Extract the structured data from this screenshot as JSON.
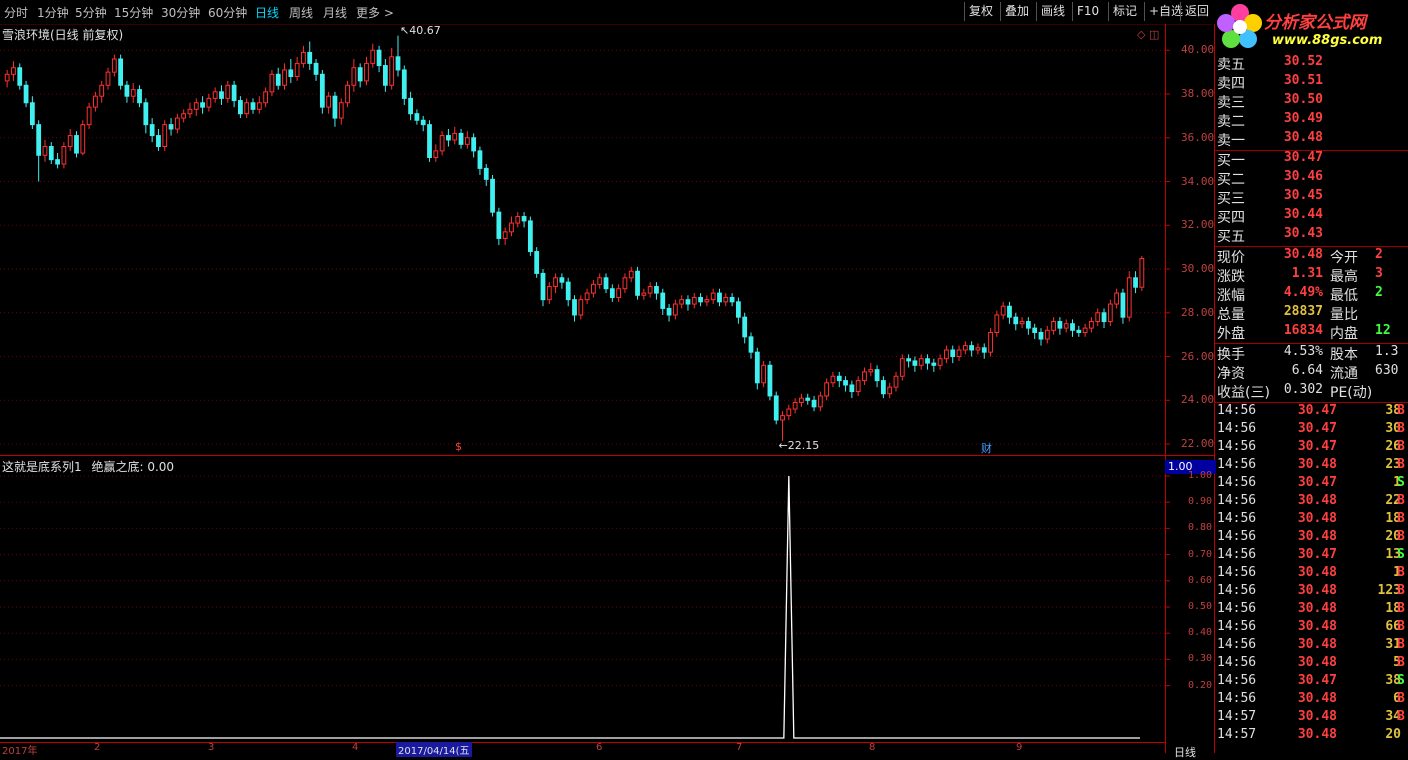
{
  "toolbar": {
    "periods": [
      "分时",
      "1分钟",
      "5分钟",
      "15分钟",
      "30分钟",
      "60分钟",
      "日线",
      "周线",
      "月线",
      "更多 >"
    ],
    "active_period": "日线",
    "buttons": [
      "复权",
      "叠加",
      "画线",
      "F10",
      "标记",
      "+自选",
      "返回"
    ]
  },
  "logo": {
    "name": "分析家公式网",
    "url": "www.88gs.com"
  },
  "main_chart": {
    "title": "雪浪环境(日线 前复权)",
    "y_labels": [
      "40.00",
      "38.00",
      "36.00",
      "34.00",
      "32.00",
      "30.00",
      "28.00",
      "26.00",
      "24.00",
      "22.00"
    ],
    "high_marker": "40.67",
    "low_marker": "22.15",
    "event_markers": [
      "$",
      "财"
    ],
    "colors": {
      "up": "#ff3030",
      "down": "#40f0f0",
      "grid": "#700000",
      "axis": "#c00000"
    }
  },
  "indicator": {
    "title": "这就是底系列1",
    "field_label": "绝赢之底:",
    "field_value": "0.00",
    "current_value": "1.00",
    "y_labels": [
      "1.00",
      "0.90",
      "0.80",
      "0.70",
      "0.60",
      "0.50",
      "0.40",
      "0.30",
      "0.20"
    ]
  },
  "x_axis": {
    "ticks": [
      "2017年",
      "2",
      "3",
      "4",
      "6",
      "7",
      "8",
      "9"
    ],
    "selected_date": "2017/04/14(五"
  },
  "order_book": {
    "asks": [
      {
        "label": "卖五",
        "price": "30.52"
      },
      {
        "label": "卖四",
        "price": "30.51"
      },
      {
        "label": "卖三",
        "price": "30.50"
      },
      {
        "label": "卖二",
        "price": "30.49"
      },
      {
        "label": "卖一",
        "price": "30.48"
      }
    ],
    "bids": [
      {
        "label": "买一",
        "price": "30.47"
      },
      {
        "label": "买二",
        "price": "30.46"
      },
      {
        "label": "买三",
        "price": "30.45"
      },
      {
        "label": "买四",
        "price": "30.44"
      },
      {
        "label": "买五",
        "price": "30.43"
      }
    ]
  },
  "quote": {
    "rows": [
      {
        "n1": "现价",
        "v1": "30.48",
        "c1": "#ff4040",
        "n2": "今开",
        "v2": "2",
        "c2": "#ff4040"
      },
      {
        "n1": "涨跌",
        "v1": "1.31",
        "c1": "#ff4040",
        "n2": "最高",
        "v2": "3",
        "c2": "#ff4040"
      },
      {
        "n1": "涨幅",
        "v1": "4.49%",
        "c1": "#ff4040",
        "n2": "最低",
        "v2": "2",
        "c2": "#40ff40"
      },
      {
        "n1": "总量",
        "v1": "28837",
        "c1": "#e0c040",
        "n2": "量比",
        "v2": "",
        "c2": "#e0e0e0"
      },
      {
        "n1": "外盘",
        "v1": "16834",
        "c1": "#ff4040",
        "n2": "内盘",
        "v2": "12",
        "c2": "#40ff40"
      }
    ],
    "rows2": [
      {
        "n1": "换手",
        "v1": "4.53%",
        "c1": "#e0e0e0",
        "n2": "股本",
        "v2": "1.3",
        "c2": "#e0e0e0"
      },
      {
        "n1": "净资",
        "v1": "6.64",
        "c1": "#e0e0e0",
        "n2": "流通",
        "v2": "630",
        "c2": "#e0e0e0"
      },
      {
        "n1": "收益(三)",
        "v1": "0.302",
        "c1": "#e0e0e0",
        "n2": "PE(动)",
        "v2": "",
        "c2": "#e0e0e0"
      }
    ]
  },
  "ticks": [
    {
      "time": "14:56",
      "price": "30.47",
      "vol": "38",
      "side": "B",
      "side_color": "#ff4040"
    },
    {
      "time": "14:56",
      "price": "30.47",
      "vol": "30",
      "side": "B",
      "side_color": "#ff4040"
    },
    {
      "time": "14:56",
      "price": "30.47",
      "vol": "26",
      "side": "B",
      "side_color": "#ff4040"
    },
    {
      "time": "14:56",
      "price": "30.48",
      "vol": "23",
      "side": "B",
      "side_color": "#ff4040"
    },
    {
      "time": "14:56",
      "price": "30.47",
      "vol": "1",
      "side": "S",
      "side_color": "#40ff40"
    },
    {
      "time": "14:56",
      "price": "30.48",
      "vol": "22",
      "side": "B",
      "side_color": "#ff4040"
    },
    {
      "time": "14:56",
      "price": "30.48",
      "vol": "18",
      "side": "B",
      "side_color": "#ff4040"
    },
    {
      "time": "14:56",
      "price": "30.48",
      "vol": "20",
      "side": "B",
      "side_color": "#ff4040"
    },
    {
      "time": "14:56",
      "price": "30.47",
      "vol": "13",
      "side": "S",
      "side_color": "#40ff40"
    },
    {
      "time": "14:56",
      "price": "30.48",
      "vol": "1",
      "side": "B",
      "side_color": "#ff4040"
    },
    {
      "time": "14:56",
      "price": "30.48",
      "vol": "123",
      "side": "B",
      "side_color": "#ff4040"
    },
    {
      "time": "14:56",
      "price": "30.48",
      "vol": "18",
      "side": "B",
      "side_color": "#ff4040"
    },
    {
      "time": "14:56",
      "price": "30.48",
      "vol": "66",
      "side": "B",
      "side_color": "#ff4040"
    },
    {
      "time": "14:56",
      "price": "30.48",
      "vol": "31",
      "side": "B",
      "side_color": "#ff4040"
    },
    {
      "time": "14:56",
      "price": "30.48",
      "vol": "5",
      "side": "B",
      "side_color": "#ff4040"
    },
    {
      "time": "14:56",
      "price": "30.47",
      "vol": "38",
      "side": "S",
      "side_color": "#40ff40"
    },
    {
      "time": "14:56",
      "price": "30.48",
      "vol": "6",
      "side": "B",
      "side_color": "#ff4040"
    },
    {
      "time": "14:57",
      "price": "30.48",
      "vol": "34",
      "side": "B",
      "side_color": "#ff4040"
    },
    {
      "time": "14:57",
      "price": "30.48",
      "vol": "20",
      "side": "",
      "side_color": "#ff4040"
    }
  ],
  "bottom_right_label": "日线",
  "chart_data": {
    "type": "candlestick",
    "title": "雪浪环境(日线 前复权)",
    "ylim": [
      21.5,
      41.2
    ],
    "candles": [
      [
        38.6,
        38.9,
        38.3,
        39.1
      ],
      [
        38.9,
        39.2,
        38.6,
        39.5
      ],
      [
        39.2,
        38.4,
        38.2,
        39.4
      ],
      [
        38.4,
        37.6,
        37.4,
        38.6
      ],
      [
        37.6,
        36.6,
        36.4,
        37.9
      ],
      [
        36.6,
        35.2,
        34.0,
        36.8
      ],
      [
        35.2,
        35.6,
        34.9,
        35.9
      ],
      [
        35.6,
        35.0,
        34.8,
        35.8
      ],
      [
        35.0,
        34.8,
        34.6,
        35.3
      ],
      [
        34.8,
        35.6,
        34.6,
        35.8
      ],
      [
        35.6,
        36.1,
        35.4,
        36.4
      ],
      [
        36.1,
        35.3,
        35.1,
        36.3
      ],
      [
        35.3,
        36.6,
        35.2,
        36.8
      ],
      [
        36.6,
        37.4,
        36.4,
        37.6
      ],
      [
        37.4,
        37.9,
        37.2,
        38.1
      ],
      [
        37.9,
        38.4,
        37.6,
        38.6
      ],
      [
        38.4,
        39.0,
        38.2,
        39.2
      ],
      [
        39.0,
        39.6,
        38.8,
        39.8
      ],
      [
        39.6,
        38.4,
        38.2,
        39.8
      ],
      [
        38.4,
        37.9,
        37.6,
        38.6
      ],
      [
        37.9,
        38.2,
        37.6,
        38.5
      ],
      [
        38.2,
        37.6,
        37.4,
        38.4
      ],
      [
        37.6,
        36.6,
        36.2,
        37.8
      ],
      [
        36.6,
        36.1,
        35.8,
        36.9
      ],
      [
        36.1,
        35.6,
        35.4,
        36.4
      ],
      [
        35.6,
        36.6,
        35.4,
        36.8
      ],
      [
        36.6,
        36.4,
        36.1,
        36.9
      ],
      [
        36.4,
        36.9,
        36.2,
        37.1
      ],
      [
        36.9,
        37.1,
        36.7,
        37.3
      ],
      [
        37.1,
        37.3,
        36.9,
        37.6
      ],
      [
        37.3,
        37.6,
        37.0,
        37.8
      ],
      [
        37.6,
        37.4,
        37.1,
        37.9
      ],
      [
        37.4,
        37.8,
        37.2,
        38.0
      ],
      [
        37.8,
        38.1,
        37.6,
        38.3
      ],
      [
        38.1,
        37.8,
        37.5,
        38.4
      ],
      [
        37.8,
        38.4,
        37.6,
        38.6
      ],
      [
        38.4,
        37.7,
        37.4,
        38.6
      ],
      [
        37.7,
        37.1,
        36.9,
        37.9
      ],
      [
        37.1,
        37.6,
        36.9,
        37.8
      ],
      [
        37.6,
        37.3,
        37.1,
        37.8
      ],
      [
        37.3,
        37.6,
        37.1,
        37.9
      ],
      [
        37.6,
        38.1,
        37.4,
        38.3
      ],
      [
        38.1,
        38.9,
        37.9,
        39.1
      ],
      [
        38.9,
        38.4,
        38.2,
        39.2
      ],
      [
        38.4,
        39.1,
        38.2,
        39.4
      ],
      [
        39.1,
        38.8,
        38.5,
        39.6
      ],
      [
        38.8,
        39.4,
        38.6,
        39.7
      ],
      [
        39.4,
        39.9,
        39.2,
        40.2
      ],
      [
        39.9,
        39.4,
        39.1,
        40.4
      ],
      [
        39.4,
        38.9,
        38.6,
        39.6
      ],
      [
        38.9,
        37.4,
        37.1,
        39.1
      ],
      [
        37.4,
        37.9,
        37.1,
        38.1
      ],
      [
        37.9,
        36.9,
        36.5,
        38.1
      ],
      [
        36.9,
        37.6,
        36.6,
        37.8
      ],
      [
        37.6,
        38.4,
        37.4,
        38.6
      ],
      [
        38.4,
        39.2,
        38.1,
        39.6
      ],
      [
        39.2,
        38.6,
        38.3,
        39.4
      ],
      [
        38.6,
        39.4,
        38.4,
        39.7
      ],
      [
        39.4,
        40.0,
        39.2,
        40.3
      ],
      [
        40.0,
        39.3,
        39.0,
        40.2
      ],
      [
        39.3,
        38.4,
        38.1,
        39.6
      ],
      [
        38.4,
        39.7,
        38.2,
        40.1
      ],
      [
        39.7,
        39.1,
        38.8,
        40.67
      ],
      [
        39.1,
        37.8,
        37.5,
        39.3
      ],
      [
        37.8,
        37.1,
        36.8,
        38.1
      ],
      [
        37.1,
        36.8,
        36.6,
        37.3
      ],
      [
        36.8,
        36.6,
        36.3,
        37.0
      ],
      [
        36.6,
        35.1,
        34.9,
        36.8
      ],
      [
        35.1,
        35.4,
        34.9,
        35.7
      ],
      [
        35.4,
        36.1,
        35.2,
        36.3
      ],
      [
        36.1,
        35.9,
        35.6,
        36.4
      ],
      [
        35.9,
        36.2,
        35.7,
        36.5
      ],
      [
        36.2,
        35.7,
        35.5,
        36.4
      ],
      [
        35.7,
        36.0,
        35.5,
        36.3
      ],
      [
        36.0,
        35.4,
        35.1,
        36.2
      ],
      [
        35.4,
        34.6,
        34.3,
        35.6
      ],
      [
        34.6,
        34.1,
        33.8,
        34.8
      ],
      [
        34.1,
        32.6,
        32.4,
        34.3
      ],
      [
        32.6,
        31.4,
        31.1,
        32.8
      ],
      [
        31.4,
        31.7,
        31.1,
        31.9
      ],
      [
        31.7,
        32.1,
        31.5,
        32.4
      ],
      [
        32.1,
        32.4,
        31.9,
        32.6
      ],
      [
        32.4,
        32.2,
        31.9,
        32.6
      ],
      [
        32.2,
        30.8,
        30.6,
        32.4
      ],
      [
        30.8,
        29.8,
        29.6,
        31.0
      ],
      [
        29.8,
        28.6,
        28.3,
        30.0
      ],
      [
        28.6,
        29.2,
        28.4,
        29.4
      ],
      [
        29.2,
        29.6,
        28.9,
        29.8
      ],
      [
        29.6,
        29.4,
        29.1,
        29.8
      ],
      [
        29.4,
        28.6,
        28.3,
        29.6
      ],
      [
        28.6,
        27.9,
        27.6,
        28.8
      ],
      [
        27.9,
        28.6,
        27.7,
        28.8
      ],
      [
        28.6,
        28.9,
        28.4,
        29.1
      ],
      [
        28.9,
        29.3,
        28.7,
        29.5
      ],
      [
        29.3,
        29.6,
        29.1,
        29.8
      ],
      [
        29.6,
        29.1,
        28.9,
        29.8
      ],
      [
        29.1,
        28.7,
        28.5,
        29.3
      ],
      [
        28.7,
        29.1,
        28.5,
        29.3
      ],
      [
        29.1,
        29.6,
        28.9,
        29.8
      ],
      [
        29.6,
        29.9,
        29.4,
        30.1
      ],
      [
        29.9,
        28.8,
        28.6,
        30.1
      ],
      [
        28.8,
        28.9,
        28.6,
        29.1
      ],
      [
        28.9,
        29.2,
        28.7,
        29.4
      ],
      [
        29.2,
        28.9,
        28.6,
        29.4
      ],
      [
        28.9,
        28.2,
        27.9,
        29.1
      ],
      [
        28.2,
        27.9,
        27.6,
        28.4
      ],
      [
        27.9,
        28.4,
        27.7,
        28.6
      ],
      [
        28.4,
        28.6,
        28.2,
        28.8
      ],
      [
        28.6,
        28.4,
        28.1,
        28.8
      ],
      [
        28.4,
        28.7,
        28.2,
        28.9
      ],
      [
        28.7,
        28.5,
        28.3,
        28.9
      ],
      [
        28.5,
        28.6,
        28.3,
        28.8
      ],
      [
        28.6,
        28.9,
        28.4,
        29.1
      ],
      [
        28.9,
        28.5,
        28.3,
        29.1
      ],
      [
        28.5,
        28.7,
        28.3,
        28.9
      ],
      [
        28.7,
        28.5,
        28.3,
        28.9
      ],
      [
        28.5,
        27.8,
        27.5,
        28.7
      ],
      [
        27.8,
        26.9,
        26.6,
        28.0
      ],
      [
        26.9,
        26.2,
        25.9,
        27.1
      ],
      [
        26.2,
        24.8,
        24.5,
        26.4
      ],
      [
        24.8,
        25.6,
        24.6,
        25.8
      ],
      [
        25.6,
        24.2,
        24.0,
        25.8
      ],
      [
        24.2,
        23.1,
        22.9,
        24.4
      ],
      [
        23.1,
        23.3,
        22.15,
        23.5
      ],
      [
        23.3,
        23.6,
        23.1,
        23.8
      ],
      [
        23.6,
        23.9,
        23.4,
        24.1
      ],
      [
        23.9,
        24.1,
        23.7,
        24.3
      ],
      [
        24.1,
        24.0,
        23.8,
        24.3
      ],
      [
        24.0,
        23.7,
        23.5,
        24.2
      ],
      [
        23.7,
        24.2,
        23.5,
        24.4
      ],
      [
        24.2,
        24.8,
        24.0,
        25.0
      ],
      [
        24.8,
        25.1,
        24.6,
        25.3
      ],
      [
        25.1,
        24.9,
        24.6,
        25.3
      ],
      [
        24.9,
        24.7,
        24.4,
        25.1
      ],
      [
        24.7,
        24.4,
        24.1,
        24.9
      ],
      [
        24.4,
        24.9,
        24.2,
        25.1
      ],
      [
        24.9,
        25.3,
        24.7,
        25.5
      ],
      [
        25.3,
        25.4,
        25.1,
        25.7
      ],
      [
        25.4,
        24.9,
        24.6,
        25.6
      ],
      [
        24.9,
        24.3,
        24.1,
        25.1
      ],
      [
        24.3,
        24.6,
        24.1,
        24.8
      ],
      [
        24.6,
        25.1,
        24.4,
        25.3
      ],
      [
        25.1,
        25.9,
        24.9,
        26.1
      ],
      [
        25.9,
        25.8,
        25.5,
        26.1
      ],
      [
        25.8,
        25.6,
        25.3,
        26.0
      ],
      [
        25.6,
        25.9,
        25.4,
        26.1
      ],
      [
        25.9,
        25.7,
        25.4,
        26.1
      ],
      [
        25.7,
        25.6,
        25.3,
        25.9
      ],
      [
        25.6,
        25.9,
        25.4,
        26.1
      ],
      [
        25.9,
        26.3,
        25.7,
        26.5
      ],
      [
        26.3,
        26.0,
        25.7,
        26.5
      ],
      [
        26.0,
        26.3,
        25.8,
        26.5
      ],
      [
        26.3,
        26.5,
        26.1,
        26.7
      ],
      [
        26.5,
        26.3,
        26.0,
        26.7
      ],
      [
        26.3,
        26.4,
        26.1,
        26.6
      ],
      [
        26.4,
        26.2,
        25.9,
        26.6
      ],
      [
        26.2,
        27.1,
        26.0,
        27.3
      ],
      [
        27.1,
        27.9,
        26.9,
        28.1
      ],
      [
        27.9,
        28.3,
        27.7,
        28.5
      ],
      [
        28.3,
        27.8,
        27.5,
        28.5
      ],
      [
        27.8,
        27.5,
        27.2,
        28.0
      ],
      [
        27.5,
        27.6,
        27.3,
        27.8
      ],
      [
        27.6,
        27.3,
        27.0,
        27.8
      ],
      [
        27.3,
        27.1,
        26.8,
        27.5
      ],
      [
        27.1,
        26.8,
        26.5,
        27.3
      ],
      [
        26.8,
        27.2,
        26.6,
        27.4
      ],
      [
        27.2,
        27.6,
        27.0,
        27.8
      ],
      [
        27.6,
        27.3,
        27.0,
        27.8
      ],
      [
        27.3,
        27.5,
        27.1,
        27.7
      ],
      [
        27.5,
        27.2,
        26.9,
        27.7
      ],
      [
        27.2,
        27.1,
        26.9,
        27.4
      ],
      [
        27.1,
        27.3,
        26.9,
        27.5
      ],
      [
        27.3,
        27.6,
        27.1,
        27.8
      ],
      [
        27.6,
        28.0,
        27.4,
        28.2
      ],
      [
        28.0,
        27.6,
        27.3,
        28.2
      ],
      [
        27.6,
        28.4,
        27.4,
        28.6
      ],
      [
        28.4,
        28.9,
        28.2,
        29.1
      ],
      [
        28.9,
        27.8,
        27.5,
        29.1
      ],
      [
        27.8,
        29.6,
        27.6,
        29.9
      ],
      [
        29.6,
        29.17,
        28.9,
        29.9
      ],
      [
        29.17,
        30.48,
        29.0,
        30.6
      ]
    ],
    "indicator_series": {
      "name": "绝赢之底",
      "spike_index": 124,
      "spike_value": 1.0,
      "baseline": 0.0
    }
  }
}
